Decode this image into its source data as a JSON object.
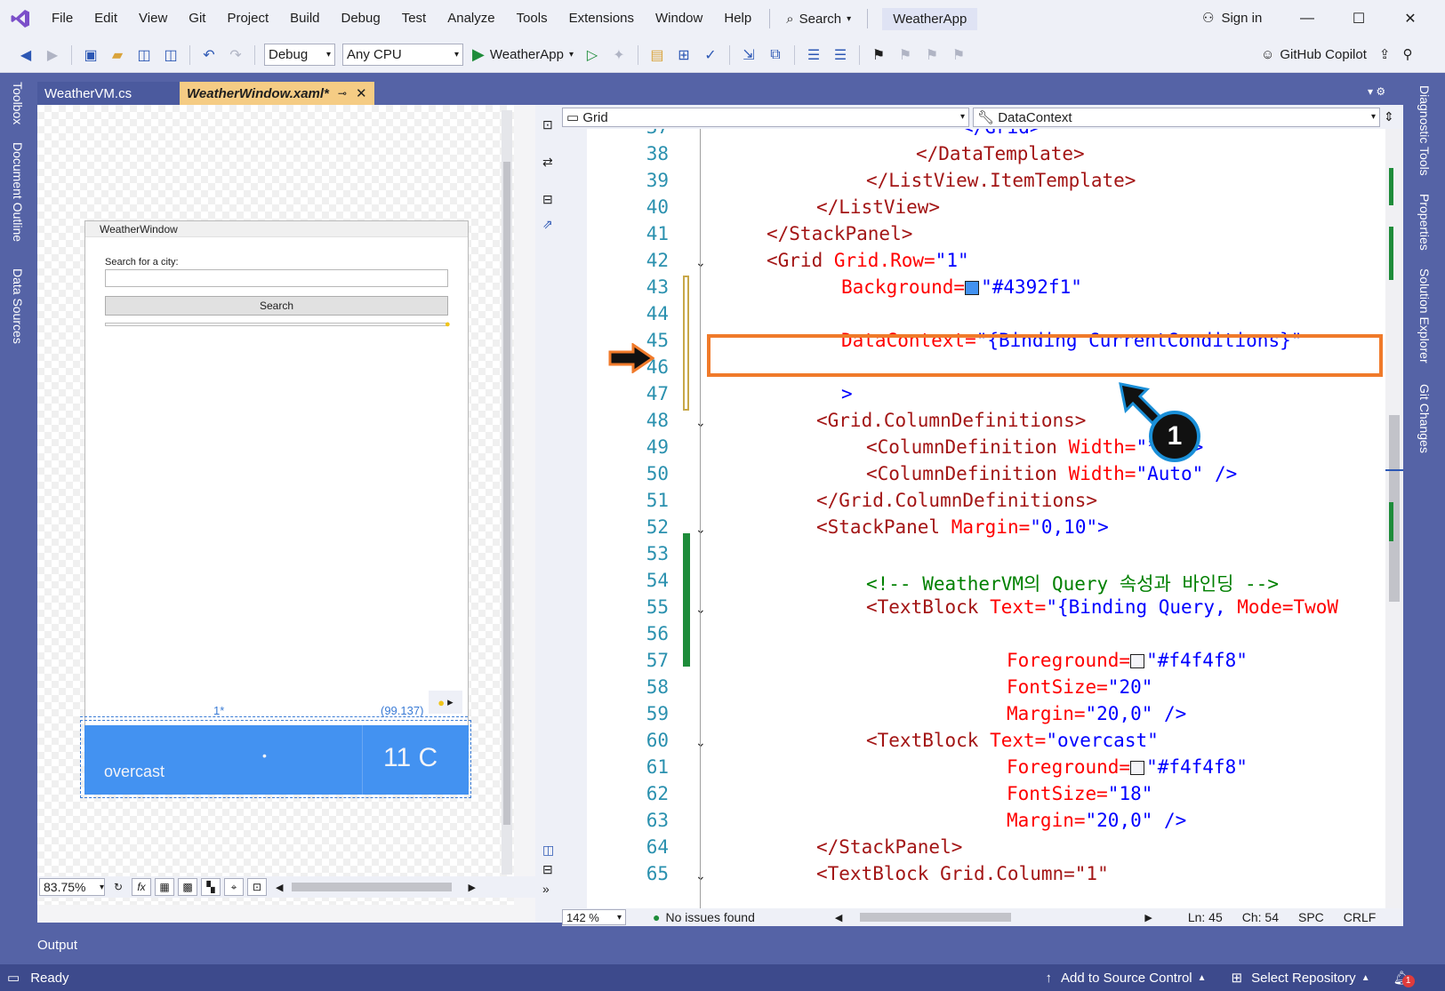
{
  "menu": {
    "items": [
      "File",
      "Edit",
      "View",
      "Git",
      "Project",
      "Build",
      "Debug",
      "Test",
      "Analyze",
      "Tools",
      "Extensions",
      "Window",
      "Help"
    ],
    "search_label": "Search",
    "solution_name": "WeatherApp",
    "sign_in": "Sign in"
  },
  "toolbar": {
    "config": "Debug",
    "platform": "Any CPU",
    "run_target": "WeatherApp",
    "copilot": "GitHub Copilot"
  },
  "left_rail": [
    "Toolbox",
    "Document Outline",
    "Data Sources"
  ],
  "right_rail": [
    "Diagnostic Tools",
    "Properties",
    "Solution Explorer",
    "Git Changes"
  ],
  "tabs": [
    {
      "label": "WeatherVM.cs",
      "active": false
    },
    {
      "label": "WeatherWindow.xaml*",
      "active": true
    }
  ],
  "designer": {
    "window_title": "WeatherWindow",
    "search_label": "Search for a city:",
    "search_button": "Search",
    "col1_marker": "1*",
    "col2_marker": "(99.137)",
    "condition": "overcast",
    "temperature": "11 C",
    "dot": "•",
    "zoom": "83.75%",
    "panel_color": "#4392f1"
  },
  "editor": {
    "nav_left": "Grid",
    "nav_right": "DataContext",
    "zoom": "142 %",
    "issues": "No issues found",
    "ln": "Ln: 45",
    "ch": "Ch: 54",
    "spc": "SPC",
    "crlf": "CRLF",
    "line_numbers": [
      "37",
      "38",
      "39",
      "40",
      "41",
      "42",
      "43",
      "44",
      "45",
      "46",
      "47",
      "48",
      "49",
      "50",
      "51",
      "52",
      "53",
      "54",
      "55",
      "56",
      "57",
      "58",
      "59",
      "60",
      "61",
      "62",
      "63",
      "64",
      "65"
    ],
    "code": {
      "l37": "</Grid>",
      "l38": "</DataTemplate>",
      "l39": "</ListView.ItemTemplate>",
      "l40": "</ListView>",
      "l41": "</StackPanel>",
      "l42_tag": "<Grid",
      "l42_attr": "Grid.Row=",
      "l42_val": "\"1\"",
      "l43_attr": "Background=",
      "l43_val": "\"#4392f1\"",
      "l45_attr": "DataContext=",
      "l45_val": "\"{Binding CurrentConditions}\"",
      "l47": ">",
      "l48": "<Grid.ColumnDefinitions>",
      "l49_tag": "<ColumnDefinition",
      "l49_attr": "Width=",
      "l49_val": "\"*\" />",
      "l50_tag": "<ColumnDefinition",
      "l50_attr": "Width=",
      "l50_val": "\"Auto\" />",
      "l51": "</Grid.ColumnDefinitions>",
      "l52_tag": "<StackPanel",
      "l52_attr": "Margin=",
      "l52_val": "\"0,10\">",
      "l54": "<!-- WeatherVM의 Query 속성과 바인딩 -->",
      "l55_tag": "<TextBlock",
      "l55_attr": "Text=",
      "l55_val": "\"{Binding Query,",
      "l55_attr2": "Mode=TwoW",
      "l57_attr": "Foreground=",
      "l57_val": "\"#f4f4f8\"",
      "l58_attr": "FontSize=",
      "l58_val": "\"20\"",
      "l59_attr": "Margin=",
      "l59_val": "\"20,0\" />",
      "l60_tag": "<TextBlock",
      "l60_attr": "Text=",
      "l60_val": "\"overcast\"",
      "l61_attr": "Foreground=",
      "l61_val": "\"#f4f4f8\"",
      "l62_attr": "FontSize=",
      "l62_val": "\"18\"",
      "l63_attr": "Margin=",
      "l63_val": "\"20,0\" />",
      "l64": "</StackPanel>",
      "l65": "<TextBlock Grid.Column=\"1\""
    }
  },
  "output_tab": "Output",
  "status": {
    "ready": "Ready",
    "add_source": "Add to Source Control",
    "select_repo": "Select Repository",
    "notif_count": "1"
  },
  "callout_number": "1",
  "colors": {
    "accent": "#5563a6",
    "highlight": "#f07a2a",
    "callout_border": "#1a8fd8"
  }
}
